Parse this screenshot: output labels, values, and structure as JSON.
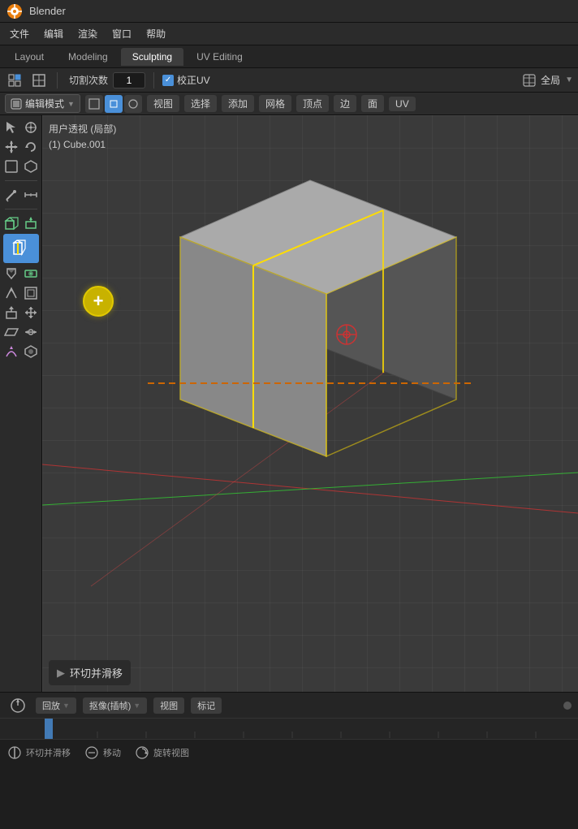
{
  "title_bar": {
    "logo_alt": "Blender Logo",
    "title": "Blender"
  },
  "menu_bar": {
    "items": [
      {
        "label": "文件",
        "id": "file"
      },
      {
        "label": "编辑",
        "id": "edit"
      },
      {
        "label": "渲染",
        "id": "render"
      },
      {
        "label": "窗口",
        "id": "window"
      },
      {
        "label": "帮助",
        "id": "help"
      }
    ]
  },
  "workspace_tabs": [
    {
      "label": "Layout",
      "active": false
    },
    {
      "label": "Modeling",
      "active": false
    },
    {
      "label": "Sculpting",
      "active": true
    },
    {
      "label": "UV Editing",
      "active": false
    }
  ],
  "tool_options": {
    "icon1_alt": "view-options-icon",
    "cube_icon_alt": "mesh-icon",
    "label_cuts": "切割次数",
    "cuts_value": "1",
    "checkbox_checked": true,
    "checkbox_label": "校正UV",
    "right_label": "全局",
    "right_icon_alt": "global-icon"
  },
  "mode_bar": {
    "mode_label": "编辑模式",
    "mode_icon_alt": "edit-mode-icon",
    "view_label": "视图",
    "select_label": "选择",
    "add_label": "添加",
    "mesh_label": "网格",
    "vertex_label": "顶点",
    "edge_label": "边",
    "face_label": "面",
    "uv_label": "UV"
  },
  "viewport": {
    "info_line1": "用户透视 (局部)",
    "info_line2": "(1) Cube.001",
    "operator_label": "环切并滑移",
    "operator_arrow": "▶"
  },
  "timeline": {
    "playback_label": "回放",
    "capture_label": "抠像(插帧)",
    "view_label": "视图",
    "marker_label": "标记"
  },
  "status_bar": {
    "loop_label": "环切并滑移",
    "loop_icon_alt": "loop-cut-icon",
    "move_label": "移动",
    "move_icon_alt": "move-icon",
    "rotate_label": "旋转视图",
    "rotate_icon_alt": "rotate-view-icon"
  },
  "toolbar": {
    "tools": [
      {
        "id": "select",
        "icon": "◈",
        "label": "Select"
      },
      {
        "id": "cursor",
        "icon": "⊕",
        "label": "Cursor"
      },
      {
        "id": "move",
        "icon": "✛",
        "label": "Move"
      },
      {
        "id": "rotate",
        "icon": "↻",
        "label": "Rotate"
      },
      {
        "id": "frame",
        "icon": "⬜",
        "label": "Frame"
      },
      {
        "id": "transform",
        "icon": "⬡",
        "label": "Transform"
      },
      {
        "id": "annotate",
        "icon": "✏",
        "label": "Annotate"
      },
      {
        "id": "measure",
        "icon": "📏",
        "label": "Measure"
      },
      {
        "id": "cube-add",
        "icon": "▣",
        "label": "Cube Add"
      },
      {
        "id": "loop-cut",
        "icon": "🔲",
        "label": "Loop Cut",
        "active": true
      },
      {
        "id": "knife",
        "icon": "◆",
        "label": "Knife"
      },
      {
        "id": "bisect",
        "icon": "◈",
        "label": "Bisect"
      },
      {
        "id": "extrude",
        "icon": "⬆",
        "label": "Extrude"
      },
      {
        "id": "inset",
        "icon": "⬡",
        "label": "Inset"
      },
      {
        "id": "bevel",
        "icon": "◈",
        "label": "Bevel"
      },
      {
        "id": "crease",
        "icon": "◆",
        "label": "Crease"
      },
      {
        "id": "shear",
        "icon": "▱",
        "label": "Shear"
      },
      {
        "id": "vertex-slide",
        "icon": "◈",
        "label": "Vertex Slide"
      }
    ]
  }
}
